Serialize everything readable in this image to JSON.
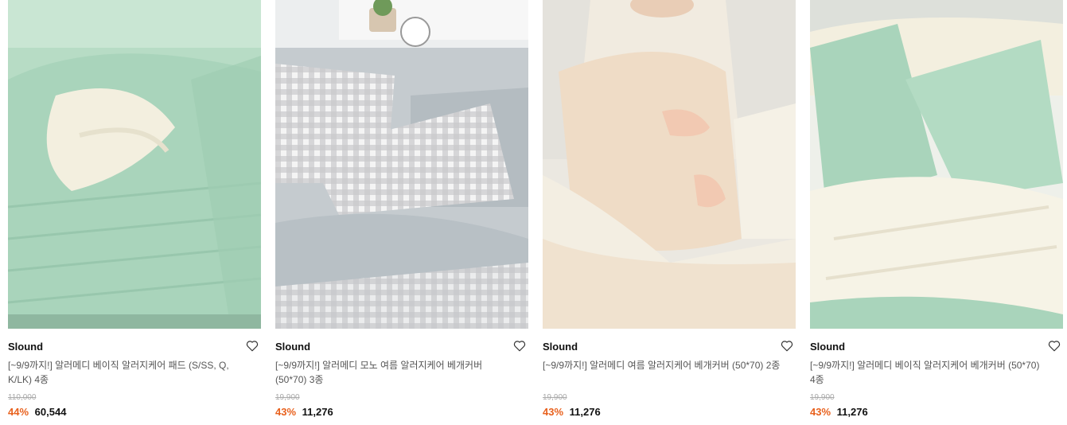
{
  "products": [
    {
      "brand": "Slound",
      "title": "[~9/9까지!] 알러메디 베이직 알러지케어 패드 (S/SS, Q, K/LK) 4종",
      "original_price": "110,000",
      "discount": "44%",
      "price": "60,544",
      "image_icon": "mint-quilted-pad-photo"
    },
    {
      "brand": "Slound",
      "title": "[~9/9까지!] 알러메디 모노 여름 알러지케어 베개커버 (50*70) 3종",
      "original_price": "19,900",
      "discount": "43%",
      "price": "11,276",
      "image_icon": "gray-gingham-pillow-photo"
    },
    {
      "brand": "Slound",
      "title": "[~9/9까지!] 알러메디 여름 알러지케어 베개커버 (50*70) 2종",
      "original_price": "19,900",
      "discount": "43%",
      "price": "11,276",
      "image_icon": "beige-pillow-hug-photo"
    },
    {
      "brand": "Slound",
      "title": "[~9/9까지!] 알러메디 베이직 알러지케어 베개커버 (50*70) 4종",
      "original_price": "19,900",
      "discount": "43%",
      "price": "11,276",
      "image_icon": "mint-ivory-pillow-photo"
    }
  ],
  "colors": {
    "discount": "#e8611d",
    "mint": "#a9d4bb",
    "gray": "#c5cbcf",
    "beige": "#f0e0cc",
    "ivory": "#f5f2e6"
  }
}
